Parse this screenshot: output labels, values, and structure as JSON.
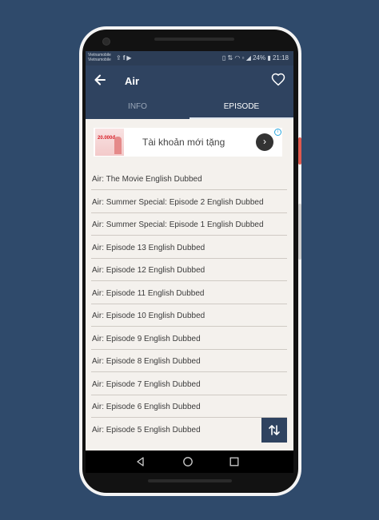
{
  "status_bar": {
    "carrier_line1": "Vietnamobile",
    "carrier_line2": "Vietnamobile",
    "left_icons": [
      "upload-icon",
      "facebook-icon",
      "youtube-icon"
    ],
    "battery": "24%",
    "time": "21:18"
  },
  "app_bar": {
    "title": "Air"
  },
  "tabs": [
    {
      "label": "INFO",
      "selected": false
    },
    {
      "label": "EPISODE",
      "selected": true
    }
  ],
  "ad": {
    "text": "Tài khoản mới tặng",
    "image_text": "20.000đ"
  },
  "episodes": [
    "Air: The Movie English Dubbed",
    "Air: Summer Special: Episode 2 English Dubbed",
    "Air: Summer Special: Episode 1 English Dubbed",
    "Air: Episode 13 English Dubbed",
    "Air: Episode 12 English Dubbed",
    "Air: Episode 11 English Dubbed",
    "Air: Episode 10 English Dubbed",
    "Air: Episode 9 English Dubbed",
    "Air: Episode 8 English Dubbed",
    "Air: Episode 7 English Dubbed",
    "Air: Episode 6 English Dubbed",
    "Air: Episode 5 English Dubbed"
  ],
  "colors": {
    "background": "#2f4a6b",
    "app_bar": "#2f4360",
    "list_background": "#f4f1ed"
  }
}
